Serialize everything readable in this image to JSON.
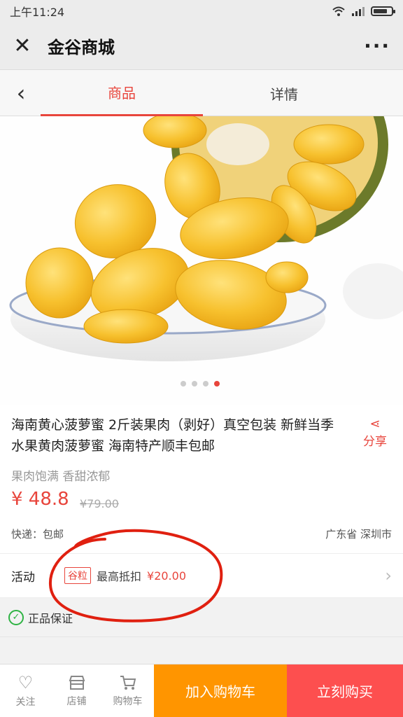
{
  "status_bar": {
    "time": "上午11:24",
    "battery_level": 0.8
  },
  "title_bar": {
    "title": "金谷商城",
    "close_symbol": "✕",
    "more_symbol": "···"
  },
  "tabs": [
    {
      "label": "商品",
      "active": true
    },
    {
      "label": "详情",
      "active": false
    }
  ],
  "gallery": {
    "image_count": 4,
    "active_index": 3
  },
  "product": {
    "title": "海南黄心菠萝蜜 2斤装果肉（剥好）真空包装 新鲜当季水果黄肉菠萝蜜 海南特产顺丰包邮",
    "subtitle": "果肉饱满 香甜浓郁",
    "price": "¥ 48.8",
    "original_price": "¥79.00",
    "shipping": "快递：包邮",
    "location": "广东省 深圳市",
    "share_label": "分享"
  },
  "activity": {
    "label": "活动",
    "tag": "谷粒",
    "text": "最高抵扣",
    "amount": "¥20.00"
  },
  "guarantee": {
    "text": "正品保证"
  },
  "bottom_bar": {
    "follow": "关注",
    "store": "店铺",
    "cart": "购物车",
    "add_to_cart": "加入购物车",
    "buy_now": "立刻购买"
  },
  "colors": {
    "accent": "#e8453c",
    "cart_button": "#ff9500",
    "buy_button": "#fd4f4f",
    "annotation": "#e02010"
  }
}
